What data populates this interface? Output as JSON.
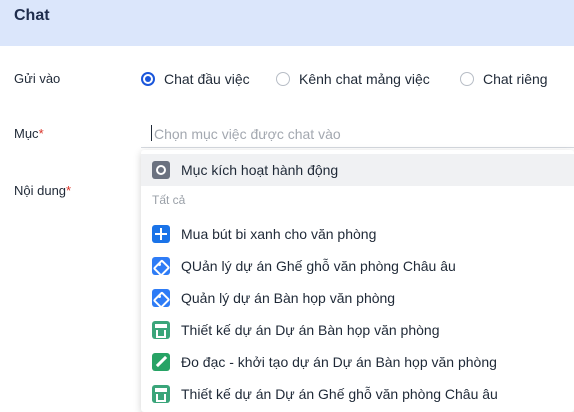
{
  "header": {
    "title": "Chat"
  },
  "form": {
    "send_to_label": "Gửi vào",
    "category_label": "Mục",
    "content_label": "Nội dung",
    "required_mark": "*",
    "radios": [
      {
        "label": "Chat đầu việc",
        "checked": true
      },
      {
        "label": "Kênh chat mảng việc",
        "checked": false
      },
      {
        "label": "Chat riêng",
        "checked": false
      }
    ],
    "category_placeholder": "Chọn mục việc được chat vào"
  },
  "dropdown": {
    "top_item": {
      "label": "Mục kích hoạt hành động",
      "icon": "target-icon"
    },
    "section_label": "Tất cả",
    "items": [
      {
        "label": "Mua bút bi xanh cho văn phòng",
        "icon": "plus-icon"
      },
      {
        "label": "QUản lý dự án Ghế ghỗ văn phòng Châu âu",
        "icon": "tag-icon"
      },
      {
        "label": "Quản lý dự án Bàn họp văn phòng",
        "icon": "tag-icon"
      },
      {
        "label": "Thiết kế dự án Dự án Bàn họp văn phòng",
        "icon": "store-icon"
      },
      {
        "label": "Đo đạc - khởi tạo dự án Dự án Bàn họp văn phòng",
        "icon": "pencil-icon"
      },
      {
        "label": "Thiết kế dự án Dự án Ghế ghỗ văn phòng Châu âu",
        "icon": "store-icon"
      }
    ]
  },
  "colors": {
    "header_bg": "#dbe6fb",
    "accent": "#1a56db",
    "required": "#d93025"
  }
}
